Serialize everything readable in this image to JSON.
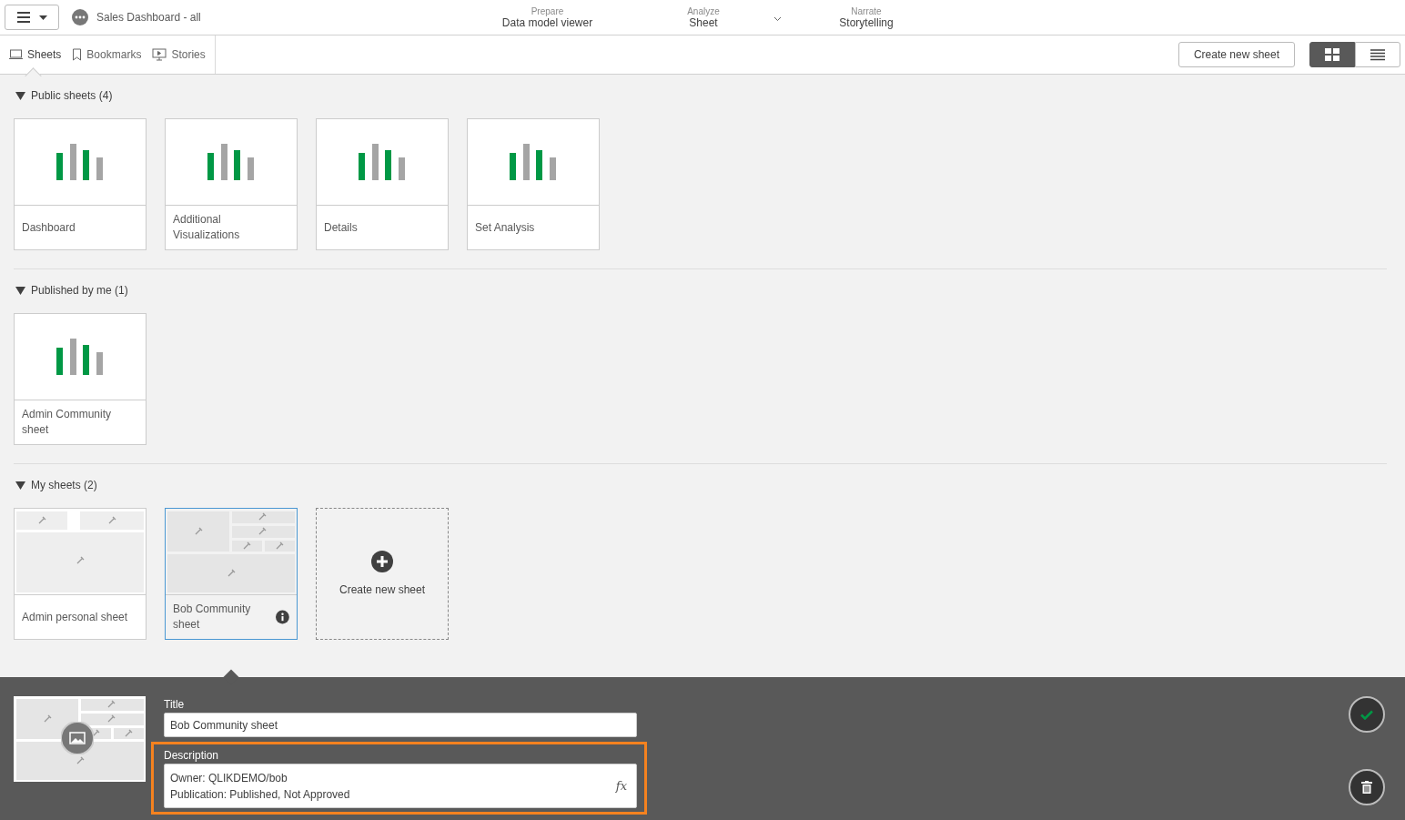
{
  "header": {
    "app_title": "Sales Dashboard - all",
    "nav": [
      {
        "caption": "Prepare",
        "label": "Data model viewer",
        "dropdown": false
      },
      {
        "caption": "Analyze",
        "label": "Sheet",
        "dropdown": true
      },
      {
        "caption": "Narrate",
        "label": "Storytelling",
        "dropdown": false
      }
    ]
  },
  "toolbar": {
    "tabs": [
      {
        "label": "Sheets",
        "selected": true
      },
      {
        "label": "Bookmarks",
        "selected": false
      },
      {
        "label": "Stories",
        "selected": false
      }
    ],
    "create_button": "Create new sheet",
    "views": [
      {
        "kind": "grid",
        "selected": true
      },
      {
        "kind": "list",
        "selected": false
      }
    ]
  },
  "sections": [
    {
      "title": "Public sheets (4)",
      "expanded": true,
      "sheets": [
        {
          "kind": "chart",
          "title": "Dashboard",
          "selected": false,
          "info": false
        },
        {
          "kind": "chart",
          "title": "Additional Visualizations",
          "selected": false,
          "info": false
        },
        {
          "kind": "chart",
          "title": "Details",
          "selected": false,
          "info": false
        },
        {
          "kind": "chart",
          "title": "Set Analysis",
          "selected": false,
          "info": false
        }
      ]
    },
    {
      "title": "Published by me (1)",
      "expanded": true,
      "sheets": [
        {
          "kind": "chart",
          "title": "Admin Community sheet",
          "selected": false,
          "info": false
        }
      ]
    },
    {
      "title": "My sheets (2)",
      "expanded": true,
      "sheets": [
        {
          "kind": "layout_simple",
          "title": "Admin personal sheet",
          "selected": false,
          "info": false
        },
        {
          "kind": "layout_grid",
          "title": "Bob Community sheet",
          "selected": true,
          "info": true
        },
        {
          "kind": "create",
          "title": "Create new sheet"
        }
      ]
    }
  ],
  "details": {
    "title_label": "Title",
    "title_value": "Bob Community sheet",
    "description_label": "Description",
    "description_lines": [
      "Owner: QLIKDEMO/bob",
      "Publication: Published, Not Approved"
    ],
    "description_highlighted": true,
    "formula_button": "fx"
  }
}
